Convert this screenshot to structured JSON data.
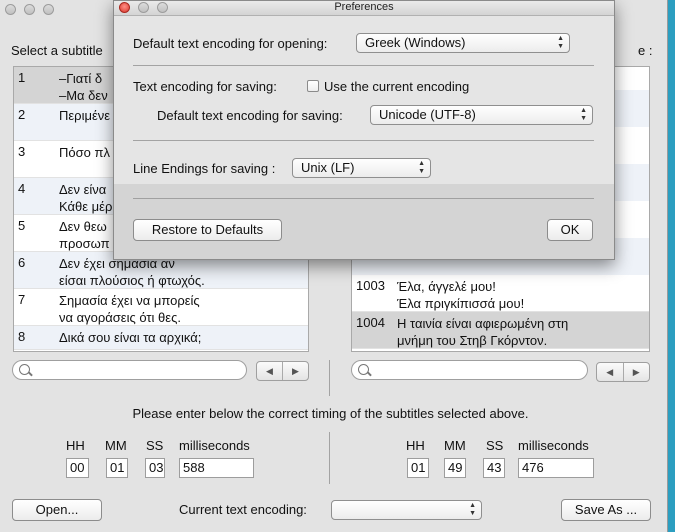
{
  "main": {
    "left_heading": "Select a subtitle",
    "right_heading_fragment": "e :",
    "left_rows": [
      {
        "num": "1",
        "text": "–Γιατί δ\n–Μα δεν"
      },
      {
        "num": "2",
        "text": "Περιμένε"
      },
      {
        "num": "3",
        "text": "Πόσο πλ"
      },
      {
        "num": "4",
        "text": "Δεν είνα\nΚάθε μέρ"
      },
      {
        "num": "5",
        "text": "Δεν θεω\nπροσωπ"
      },
      {
        "num": "6",
        "text": "Δεν έχει σημασία αν\nείσαι πλούσιος ή φτωχός."
      },
      {
        "num": "7",
        "text": "Σημασία έχει να μπορείς\nνα αγοράσεις ότι θες."
      },
      {
        "num": "8",
        "text": "Δικά σου είναι τα αρχικά;"
      }
    ],
    "right_rows": [
      {
        "num": "1003",
        "text": "Έλα, άγγελέ μου!\nΈλα πριγκίπισσά μου!"
      },
      {
        "num": "1004",
        "text": "Η ταινία είναι αφιερωμένη στη\nμνήμη του Στηβ Γκόρντον."
      }
    ],
    "instruction": "Please enter below the correct timing of the subtitles selected above.",
    "timing_labels": {
      "hh": "HH",
      "mm": "MM",
      "ss": "SS",
      "ms": "milliseconds"
    },
    "left_timing": {
      "hh": "00",
      "mm": "01",
      "ss": "03",
      "ms": "588"
    },
    "right_timing": {
      "hh": "01",
      "mm": "49",
      "ss": "43",
      "ms": "476"
    },
    "open_button": "Open...",
    "current_encoding_label": "Current text encoding:",
    "current_encoding_value": "",
    "save_as_button": "Save As ..."
  },
  "prefs": {
    "title": "Preferences",
    "opening_label": "Default text encoding for opening:",
    "opening_value": "Greek (Windows)",
    "saving_label": "Text encoding for saving:",
    "use_current_label": "Use the current encoding",
    "use_current_checked": false,
    "default_saving_label": "Default text encoding for saving:",
    "default_saving_value": "Unicode (UTF-8)",
    "line_endings_label": "Line Endings for saving :",
    "line_endings_value": "Unix (LF)",
    "restore_button": "Restore to Defaults",
    "ok_button": "OK"
  }
}
